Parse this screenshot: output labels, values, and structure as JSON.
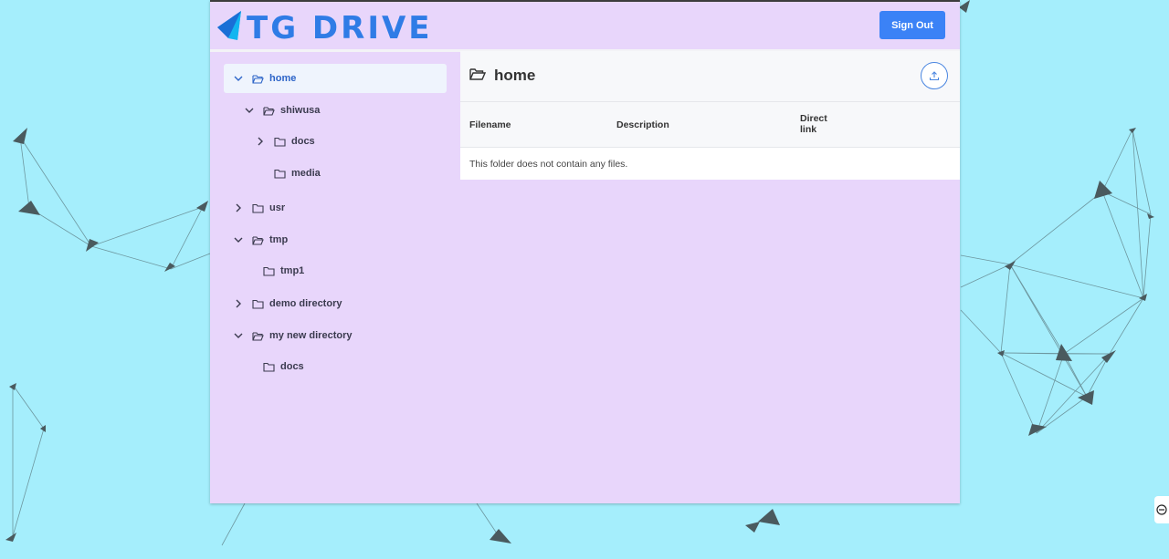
{
  "header": {
    "app_title": "TG DRIVE",
    "sign_out_label": "Sign Out",
    "logo_icon": "paper-plane-logo-icon",
    "accent_color": "#2f7ce6",
    "button_color": "#3b82f6"
  },
  "tree": {
    "items": [
      {
        "label": "home",
        "expanded": true,
        "selected": true
      },
      {
        "label": "shiwusa",
        "expanded": true
      },
      {
        "label": "docs",
        "expanded": false
      },
      {
        "label": "media",
        "expanded": null
      },
      {
        "label": "usr",
        "expanded": false
      },
      {
        "label": "tmp",
        "expanded": true
      },
      {
        "label": "tmp1",
        "expanded": null
      },
      {
        "label": "demo directory",
        "expanded": false
      },
      {
        "label": "my new directory",
        "expanded": true
      },
      {
        "label": "docs",
        "expanded": null
      }
    ]
  },
  "panel": {
    "current_folder": "home",
    "upload_icon": "upload-icon",
    "columns": [
      "Filename",
      "Description",
      "Direct",
      "link"
    ],
    "empty_message": "This folder does not contain any files."
  },
  "background_color": "#a5eefc",
  "sidebar_color": "#e8d6fb"
}
